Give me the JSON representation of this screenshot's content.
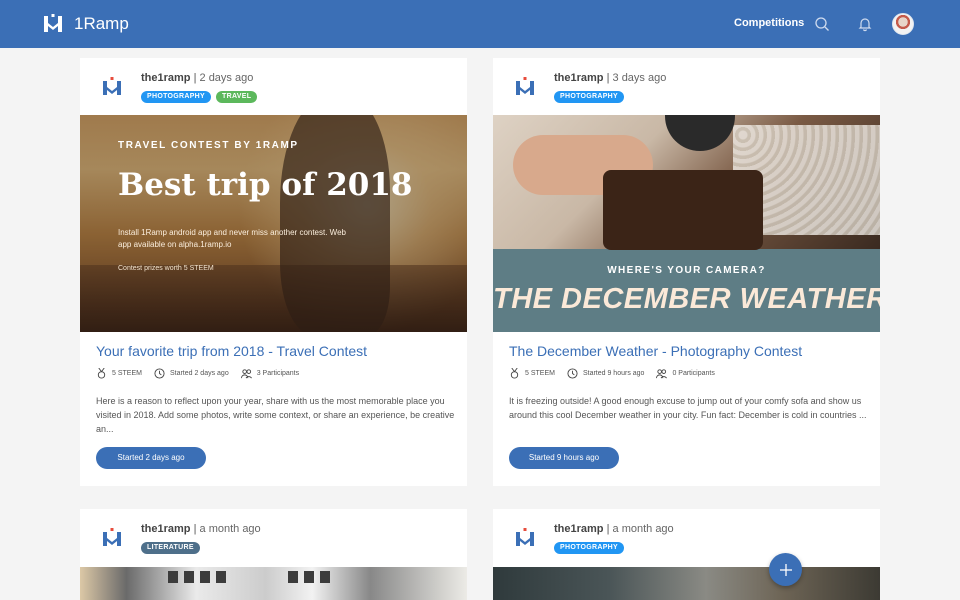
{
  "app": {
    "name": "1Ramp"
  },
  "nav": {
    "competitions_label": "Competitions"
  },
  "colors": {
    "primary": "#3b6fb6",
    "tag_photography": "#2196f3",
    "tag_travel": "#5cb85c",
    "tag_literature": "#4e6f8a"
  },
  "icons": {
    "logo": "1ramp-logo-icon",
    "search": "search-icon",
    "notifications": "bell-icon",
    "add": "plus-icon",
    "prize": "medal-icon",
    "started": "clock-icon",
    "participants": "people-icon"
  },
  "cards": [
    {
      "author": "the1ramp",
      "separator": "|",
      "time": "2 days ago",
      "tags": [
        "PHOTOGRAPHY",
        "TRAVEL"
      ],
      "hero": {
        "kicker": "TRAVEL CONTEST BY 1RAMP",
        "title": "Best trip of 2018",
        "body": "Install 1Ramp android app and never miss another contest. Web app available on alpha.1ramp.io",
        "small": "Contest prizes worth 5 STEEM"
      },
      "title": "Your favorite trip from 2018 - Travel Contest",
      "prize": "5 STEEM",
      "started": "Started 2 days ago",
      "participants": "3 Participants",
      "description": "Here is a reason to reflect upon your year, share with us the most memorable place you visited in 2018. Add some photos, write some context, or share an experience, be creative an...",
      "button_label": "Started 2 days ago"
    },
    {
      "author": "the1ramp",
      "separator": "|",
      "time": "3 days ago",
      "tags": [
        "PHOTOGRAPHY"
      ],
      "hero": {
        "kicker": "WHERE'S YOUR CAMERA?",
        "title": "THE DECEMBER WEATHER"
      },
      "title": "The December Weather - Photography Contest",
      "prize": "5 STEEM",
      "started": "Started 9 hours ago",
      "participants": "0 Participants",
      "description": "It is freezing outside! A good enough excuse to jump out of your comfy sofa and show us around this cool December weather in your city. Fun fact: December is cold in countries ...",
      "button_label": "Started 9 hours ago"
    },
    {
      "author": "the1ramp",
      "separator": "|",
      "time": "a month ago",
      "tags": [
        "LITERATURE"
      ]
    },
    {
      "author": "the1ramp",
      "separator": "|",
      "time": "a month ago",
      "tags": [
        "PHOTOGRAPHY"
      ]
    }
  ]
}
